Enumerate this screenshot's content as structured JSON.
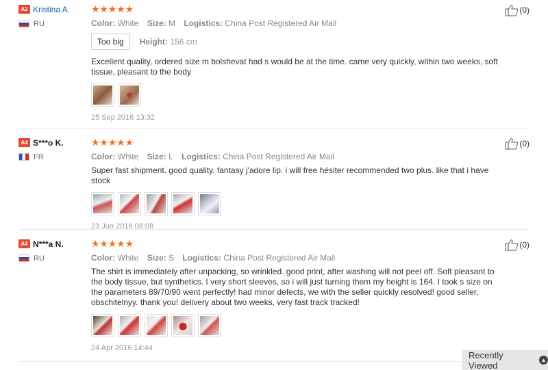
{
  "reviews": [
    {
      "badge": "A2",
      "name": "Kristina A.",
      "country": "RU",
      "stars": [
        "★",
        "★",
        "★",
        "★",
        "★"
      ],
      "color_label": "Color:",
      "color": "White",
      "size_label": "Size:",
      "size": "M",
      "logistics_label": "Logistics:",
      "logistics": "China Post Registered Air Mail",
      "fit_tag": "Too big",
      "height_label": "Height:",
      "height": "156 cm",
      "text": "Excellent quality, ordered size m bolshevat had s would be at the time. came very quickly, within two weeks, soft tissue, pleasant to the body",
      "date": "25 Sep 2016 13:32",
      "likes": "(0)"
    },
    {
      "badge": "A4",
      "name": "S***o K.",
      "country": "FR",
      "stars": [
        "★",
        "★",
        "★",
        "★",
        "★"
      ],
      "color_label": "Color:",
      "color": "White",
      "size_label": "Size:",
      "size": "L",
      "logistics_label": "Logistics:",
      "logistics": "China Post Registered Air Mail",
      "text": "Super fast shipment. good quality. fantasy j'adore lip. i will free hésiter recommended two plus. like that i have stock",
      "date": "23 Jun 2016 08:08",
      "likes": "(0)"
    },
    {
      "badge": "A4",
      "name": "N***a N.",
      "country": "RU",
      "stars": [
        "★",
        "★",
        "★",
        "★",
        "★"
      ],
      "color_label": "Color:",
      "color": "White",
      "size_label": "Size:",
      "size": "S",
      "logistics_label": "Logistics:",
      "logistics": "China Post Registered Air Mail",
      "text": "The shirt is immediately after unpacking, so wrinkled. good print, after washing will not peel off. Soft pleasant to the body tissue, but synthetics. I very short sleeves, so i will just turning them my height is 164. I took s size on the parameters 89/70/90 went perfectly! had minor defects, we with the seller quickly resolved! good seller, obschitelnyy. thank you! delivery about two weeks, very fast track tracked!",
      "date": "24 Apr 2016 14:44",
      "likes": "(0)"
    }
  ],
  "recently_viewed": "Recently Viewed",
  "colors": {
    "star": "#f56f22",
    "badge": "#e34a2f",
    "link": "#1d5fa8"
  }
}
